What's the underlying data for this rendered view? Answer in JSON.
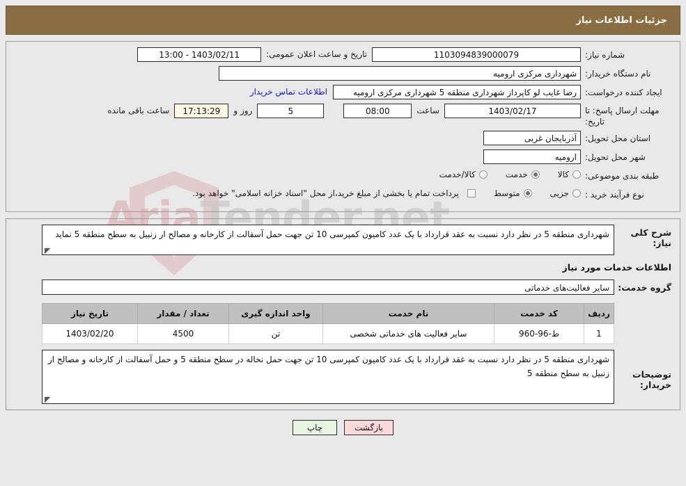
{
  "header": {
    "title": "جزئیات اطلاعات نیاز"
  },
  "form": {
    "need_number_label": "شماره نیاز:",
    "need_number_value": "1103094839000079",
    "announce_label": "تاریخ و ساعت اعلان عمومی:",
    "announce_value": "1403/02/11 - 13:00",
    "buyer_org_label": "نام دستگاه خریدار:",
    "buyer_org_value": "شهرداری مرکزی ارومیه",
    "creator_label": "ایجاد کننده درخواست:",
    "creator_value": "رضا غایب لو کاپرداز شهرداری منطقه 5 شهرداری مرکزی ارومیه",
    "contact_link": "اطلاعات تماس خریدار",
    "deadline_label": "مهلت ارسال پاسخ: تا تاریخ:",
    "deadline_date": "1403/02/17",
    "hour_label": "ساعت",
    "deadline_hour": "08:00",
    "days_value": "5",
    "days_label": "روز و",
    "countdown_value": "17:13:29",
    "remaining_label": "ساعت باقی مانده",
    "province_label": "استان محل تحویل:",
    "province_value": "آذربایجان غربی",
    "city_label": "شهر محل تحویل:",
    "city_value": "ارومیه",
    "category_label": "طبقه بندی موضوعی:",
    "category_options": [
      {
        "label": "کالا",
        "selected": false
      },
      {
        "label": "خدمت",
        "selected": true
      },
      {
        "label": "کالا/خدمت",
        "selected": false
      }
    ],
    "process_label": "نوع فرآیند خرید :",
    "process_options": [
      {
        "label": "جزیی",
        "selected": false
      },
      {
        "label": "متوسط",
        "selected": true
      }
    ],
    "treasury_checkbox_label": "پرداخت تمام یا بخشی از مبلغ خرید،از محل \"اسناد خزانه اسلامی\" خواهد بود.",
    "treasury_checked": false
  },
  "need_description": {
    "label": "شرح کلی نیاز:",
    "value": "شهرداری منطقه 5 در نظر دارد نسبت به عقد قرارداد با یک عدد کامیون کمپرسی 10 تن جهت حمل آسفالت از کارخانه و مصالح ار زنبیل به سطح منطقه 5 نماید"
  },
  "services": {
    "section_title": "اطلاعات خدمات مورد نیاز",
    "group_label": "گروه خدمت:",
    "group_value": "سایر فعالیت‌های خدماتی",
    "columns": [
      "ردیف",
      "کد خدمت",
      "نام خدمت",
      "واحد اندازه گیری",
      "تعداد / مقدار",
      "تاریخ نیاز"
    ],
    "rows": [
      {
        "row": "1",
        "code": "ط-96-960",
        "name": "سایر فعالیت های خدماتی شخصی",
        "unit": "تن",
        "quantity": "4500",
        "need_date": "1403/02/20"
      }
    ]
  },
  "buyer_notes": {
    "label": "توضیحات خریدار:",
    "value": "شهرداری منطقه 5 در نظر دارد نسبت به عقد قرارداد با یک عدد کامیون کمپرسی 10 تن جهت حمل نخاله در سطح منطقه 5 و حمل آسفالت از کارخانه و مصالح ار زنبیل به سطح منطقه 5"
  },
  "footer": {
    "back_label": "بازگشت",
    "print_label": "چاپ"
  },
  "watermark": {
    "text_left": "Aria",
    "text_right": "Tender.net"
  },
  "colors": {
    "header_bg": "#8a6e43",
    "link": "#1313d6",
    "table_header_bg": "#c0c0c0",
    "back_btn_bg": "#fbd9da",
    "print_btn_bg": "#e6f6e3",
    "countdown_bg": "#fbf8e3",
    "page_bg": "#e9e9e9"
  }
}
